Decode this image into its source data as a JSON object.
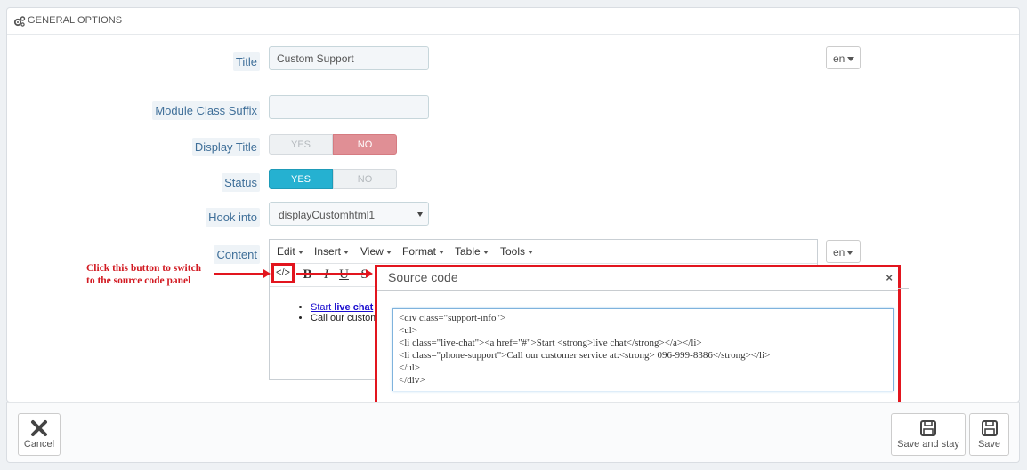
{
  "panel": {
    "title": "GENERAL OPTIONS"
  },
  "form": {
    "title_label": "Title",
    "title_value": "Custom Support",
    "lang": "en",
    "suffix_label": "Module Class Suffix",
    "suffix_value": "",
    "display_title_label": "Display Title",
    "display_title": {
      "yes": "YES",
      "no": "NO",
      "selected": "NO"
    },
    "status_label": "Status",
    "status": {
      "yes": "YES",
      "no": "NO",
      "selected": "YES"
    },
    "hook_label": "Hook into",
    "hook_value": "displayCustomhtml1",
    "content_label": "Content",
    "content_lang": "en"
  },
  "editor": {
    "menu": [
      "Edit",
      "Insert",
      "View",
      "Format",
      "Table",
      "Tools"
    ],
    "toolbar": {
      "source": "</>",
      "bold": "B",
      "italic": "I",
      "underline": "U",
      "strike": "S"
    },
    "preview": {
      "item1_link": "Start",
      "item1_strong": "live chat",
      "item2": "Call our custom"
    }
  },
  "annotation": {
    "line1": "Click this button to switch",
    "line2": "to the source code panel"
  },
  "modal": {
    "title": "Source code",
    "close": "×",
    "code_lines": [
      "<div class=\"support-info\">",
      "<ul>",
      "<li class=\"live-chat\"><a href=\"#\">Start <strong>live chat</strong></a></li>",
      "<li class=\"phone-support\">Call our customer service at:<strong> 096-999-8386</strong></li>",
      "</ul>",
      "</div>"
    ]
  },
  "footer": {
    "cancel": "Cancel",
    "save_stay": "Save and stay",
    "save": "Save"
  },
  "colors": {
    "accent_blue": "#25b1d1",
    "toggle_red": "#e08f95",
    "annotation_red": "#e2151e"
  }
}
